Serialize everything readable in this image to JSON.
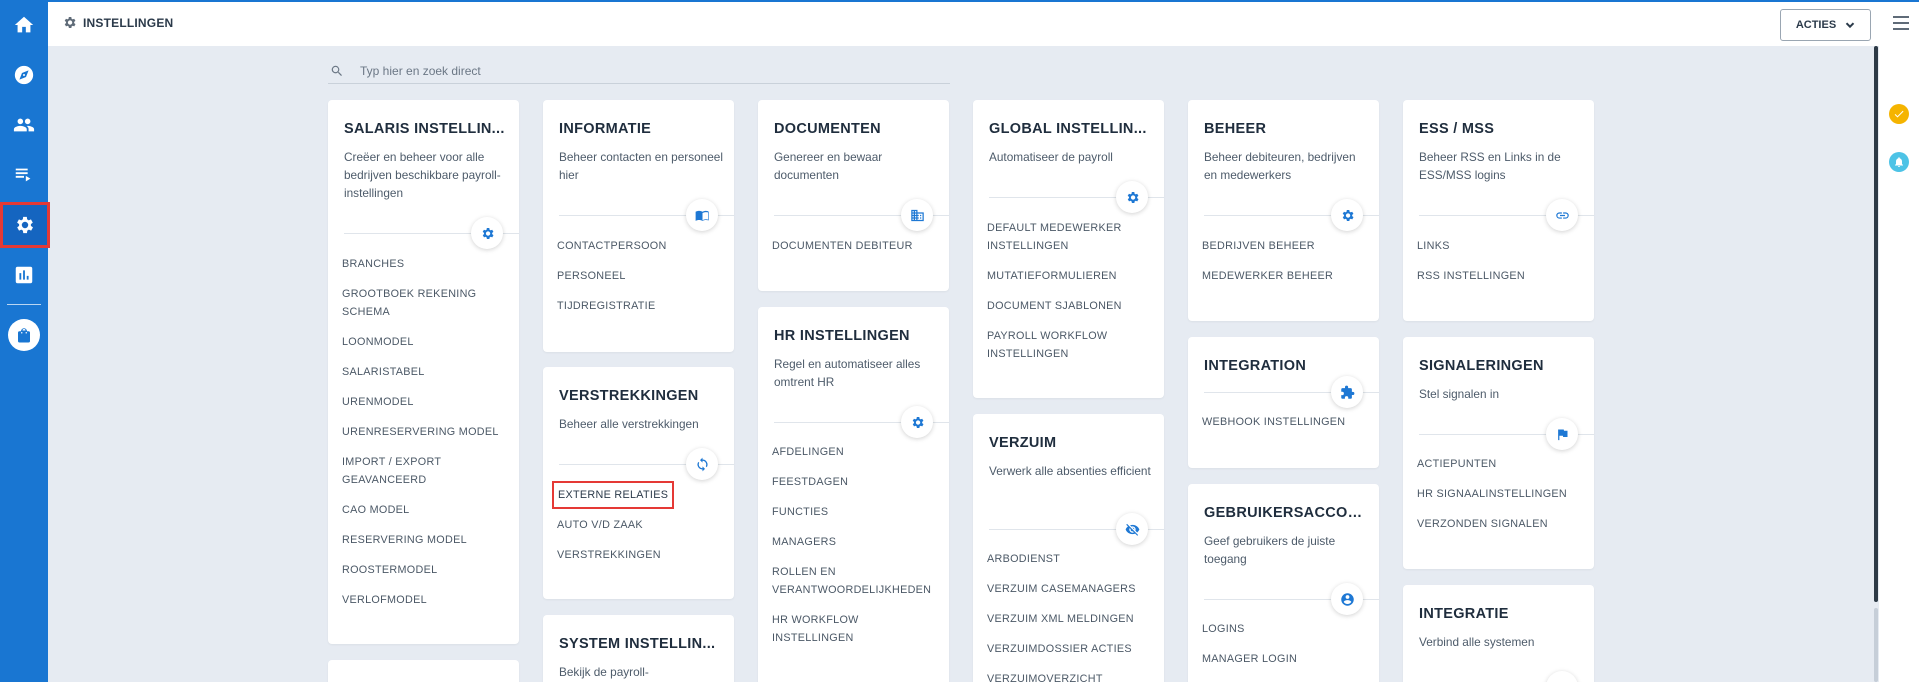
{
  "header": {
    "title": "INSTELLINGEN",
    "actions_label": "ACTIES"
  },
  "search": {
    "placeholder": "Typ hier en zoek direct"
  },
  "colors": {
    "rail": "#1976d2",
    "accent": "#1e78d4",
    "highlight": "#e53935",
    "notification_yellow": "#f5b400",
    "notification_cyan": "#4dc3e6"
  },
  "nav_rail": {
    "items": [
      "home-icon",
      "compass-icon",
      "people-icon",
      "list-icon",
      "gear-icon",
      "chart-icon",
      "shopping-bag-icon"
    ],
    "selected": "gear-icon"
  },
  "cards": {
    "salaris": {
      "title": "SALARIS INSTELLIN...",
      "description": "Creëer en beheer voor alle bedrijven beschikbare payroll-instellingen",
      "icon": "gear-icon",
      "links": [
        "BRANCHES",
        "GROOTBOEK REKENING SCHEMA",
        "LOONMODEL",
        "SALARISTABEL",
        "URENMODEL",
        "URENRESERVERING MODEL",
        "IMPORT / EXPORT GEAVANCEERD",
        "CAO MODEL",
        "RESERVERING MODEL",
        "ROOSTERMODEL",
        "VERLOFMODEL"
      ]
    },
    "informatie": {
      "title": "INFORMATIE",
      "description": "Beheer contacten en personeel hier",
      "icon": "book-icon",
      "links": [
        "CONTACTPERSOON",
        "PERSONEEL",
        "TIJDREGISTRATIE"
      ]
    },
    "verstrekkingen": {
      "title": "VERSTREKKINGEN",
      "description": "Beheer alle verstrekkingen",
      "icon": "sync-icon",
      "links": [
        "EXTERNE RELATIES",
        "AUTO V/D ZAAK",
        "VERSTREKKINGEN"
      ],
      "highlighted_link": "EXTERNE RELATIES"
    },
    "system": {
      "title": "SYSTEM INSTELLIN...",
      "description": "Bekijk de payroll-"
    },
    "documenten": {
      "title": "DOCUMENTEN",
      "description": "Genereer en bewaar documenten",
      "icon": "building-icon",
      "links": [
        "DOCUMENTEN DEBITEUR"
      ]
    },
    "hr": {
      "title": "HR INSTELLINGEN",
      "description": "Regel en automatiseer alles omtrent HR",
      "icon": "gear-icon",
      "links": [
        "AFDELINGEN",
        "FEESTDAGEN",
        "FUNCTIES",
        "MANAGERS",
        "ROLLEN EN VERANTWOORDELIJKHEDEN",
        "HR WORKFLOW INSTELLINGEN"
      ]
    },
    "global": {
      "title": "GLOBAL INSTELLIN...",
      "description": "Automatiseer de payroll",
      "icon": "gear-icon",
      "links": [
        "DEFAULT MEDEWERKER INSTELLINGEN",
        "MUTATIEFORMULIEREN",
        "DOCUMENT SJABLONEN",
        "PAYROLL WORKFLOW INSTELLINGEN"
      ]
    },
    "verzuim": {
      "title": "VERZUIM",
      "description": "Verwerk alle absenties efficient",
      "icon": "eye-off-icon",
      "links": [
        "ARBODIENST",
        "VERZUIM CASEMANAGERS",
        "VERZUIM XML MELDINGEN",
        "VERZUIMDOSSIER ACTIES",
        "VERZUIMOVERZICHT"
      ]
    },
    "beheer": {
      "title": "BEHEER",
      "description": "Beheer debiteuren, bedrijven en medewerkers",
      "icon": "gear-icon",
      "links": [
        "BEDRIJVEN BEHEER",
        "MEDEWERKER BEHEER"
      ]
    },
    "integration": {
      "title": "INTEGRATION",
      "description": "",
      "icon": "puzzle-icon",
      "links": [
        "WEBHOOK INSTELLINGEN"
      ]
    },
    "gebruikers": {
      "title": "GEBRUIKERSACCOU...",
      "description": "Geef gebruikers de juiste toegang",
      "icon": "account-icon",
      "links": [
        "LOGINS",
        "MANAGER LOGIN"
      ]
    },
    "ess": {
      "title": "ESS / MSS",
      "description": "Beheer RSS en Links in de ESS/MSS logins",
      "icon": "link-icon",
      "links": [
        "LINKS",
        "RSS INSTELLINGEN"
      ]
    },
    "signaleringen": {
      "title": "SIGNALERINGEN",
      "description": "Stel signalen in",
      "icon": "flag-icon",
      "links": [
        "ACTIEPUNTEN",
        "HR SIGNAALINSTELLINGEN",
        "VERZONDEN SIGNALEN"
      ]
    },
    "integratie": {
      "title": "INTEGRATIE",
      "description": "Verbind alle systemen",
      "icon": "gear-icon"
    }
  }
}
